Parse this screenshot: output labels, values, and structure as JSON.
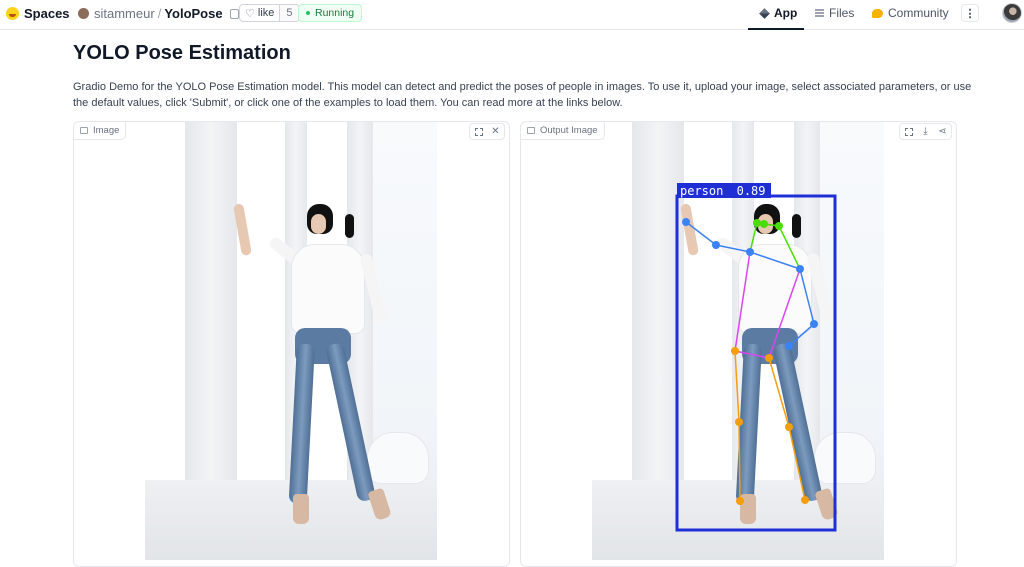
{
  "header": {
    "brand": "Spaces",
    "owner": "sitammeur",
    "separator": "/",
    "repo": "YoloPose",
    "like_label": "like",
    "like_count": "5",
    "status": "Running",
    "tabs": [
      {
        "label": "App",
        "icon": "cube-icon",
        "active": true
      },
      {
        "label": "Files",
        "icon": "files-icon",
        "active": false
      },
      {
        "label": "Community",
        "icon": "community-icon",
        "active": false
      }
    ],
    "more_icon": "⋮"
  },
  "main": {
    "title": "YOLO Pose Estimation",
    "description": "Gradio Demo for the YOLO Pose Estimation model. This model can detect and predict the poses of people in images. To use it, upload your image, select associated parameters, or use the default values, click 'Submit', or click one of the examples to load them. You can read more at the links below."
  },
  "input_panel": {
    "label": "Image",
    "tools": [
      "expand-icon",
      "close-icon"
    ],
    "close_glyph": "✕"
  },
  "output_panel": {
    "label": "Output Image",
    "tools": [
      "expand-icon",
      "download-icon",
      "share-icon"
    ],
    "download_glyph": "⤓",
    "share_glyph": "⋖",
    "detection": {
      "class": "person",
      "score": "0.89",
      "box_color": "#1f2fd6"
    }
  },
  "colors": {
    "accent": "#111827",
    "running": "#15803d",
    "keypoint_face": "#4ade00",
    "keypoint_arm": "#3b82f6",
    "keypoint_leg": "#f59e0b"
  }
}
